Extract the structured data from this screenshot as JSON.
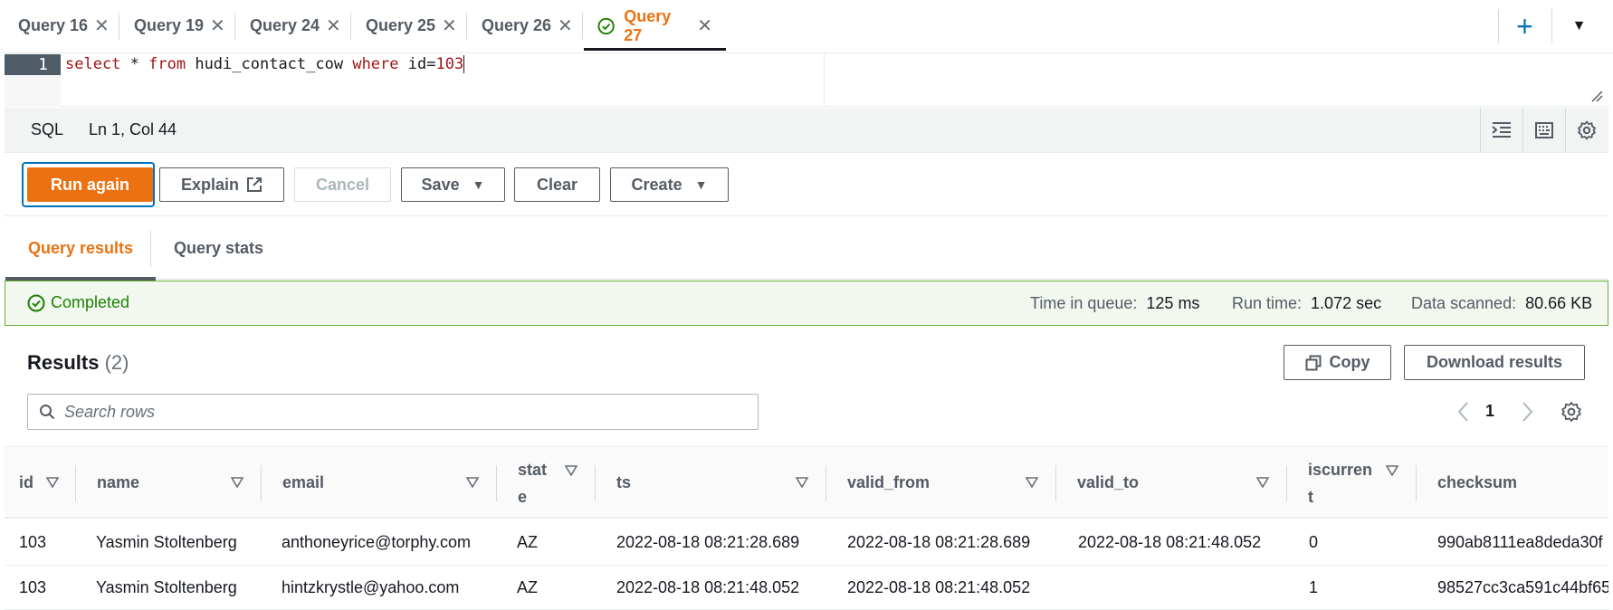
{
  "tabs": [
    {
      "label": "Query 16"
    },
    {
      "label": "Query 19"
    },
    {
      "label": "Query 24"
    },
    {
      "label": "Query 25"
    },
    {
      "label": "Query 26"
    },
    {
      "label": "Query 27",
      "active": true,
      "status": "completed"
    }
  ],
  "tab_actions": {
    "add": "+",
    "menu": "▼"
  },
  "editor": {
    "line_number": "1",
    "code": "select * from hudi_contact_cow where id=103",
    "tokens": {
      "select": "select",
      "star": " * ",
      "from": "from",
      "table": " hudi_contact_cow ",
      "where": "where",
      "col": " id=",
      "value": "103"
    }
  },
  "statusbar": {
    "language": "SQL",
    "position": "Ln 1, Col 44",
    "icons": [
      "format-icon",
      "keyboard-icon",
      "settings-icon"
    ]
  },
  "actions": {
    "run_again": "Run again",
    "explain": "Explain",
    "cancel": "Cancel",
    "save": "Save",
    "clear": "Clear",
    "create": "Create"
  },
  "result_tabs": {
    "results": "Query results",
    "stats": "Query stats"
  },
  "status": {
    "text": "Completed",
    "time_in_queue_label": "Time in queue:",
    "time_in_queue": "125 ms",
    "run_time_label": "Run time:",
    "run_time": "1.072 sec",
    "data_scanned_label": "Data scanned:",
    "data_scanned": "80.66 KB"
  },
  "results": {
    "title": "Results",
    "count": "(2)",
    "copy": "Copy",
    "download": "Download results",
    "search_placeholder": "Search rows",
    "page": "1"
  },
  "table": {
    "headers": {
      "id": "id",
      "name": "name",
      "email": "email",
      "state_1": "stat",
      "state_2": "e",
      "ts": "ts",
      "valid_from": "valid_from",
      "valid_to": "valid_to",
      "iscurrent_1": "iscurren",
      "iscurrent_2": "t",
      "checksum": "checksum"
    },
    "rows": [
      {
        "id": "103",
        "name": "Yasmin Stoltenberg",
        "email": "anthoneyrice@torphy.com",
        "state": "AZ",
        "ts": "2022-08-18 08:21:28.689",
        "valid_from": "2022-08-18 08:21:28.689",
        "valid_to": "2022-08-18 08:21:48.052",
        "iscurrent": "0",
        "checksum": "990ab8111ea8deda30f"
      },
      {
        "id": "103",
        "name": "Yasmin Stoltenberg",
        "email": "hintzkrystle@yahoo.com",
        "state": "AZ",
        "ts": "2022-08-18 08:21:48.052",
        "valid_from": "2022-08-18 08:21:48.052",
        "valid_to": "",
        "iscurrent": "1",
        "checksum": "98527cc3ca591c44bf65"
      }
    ]
  },
  "colors": {
    "accent": "#ec7211",
    "success": "#1d8102",
    "link": "#0073bb"
  }
}
